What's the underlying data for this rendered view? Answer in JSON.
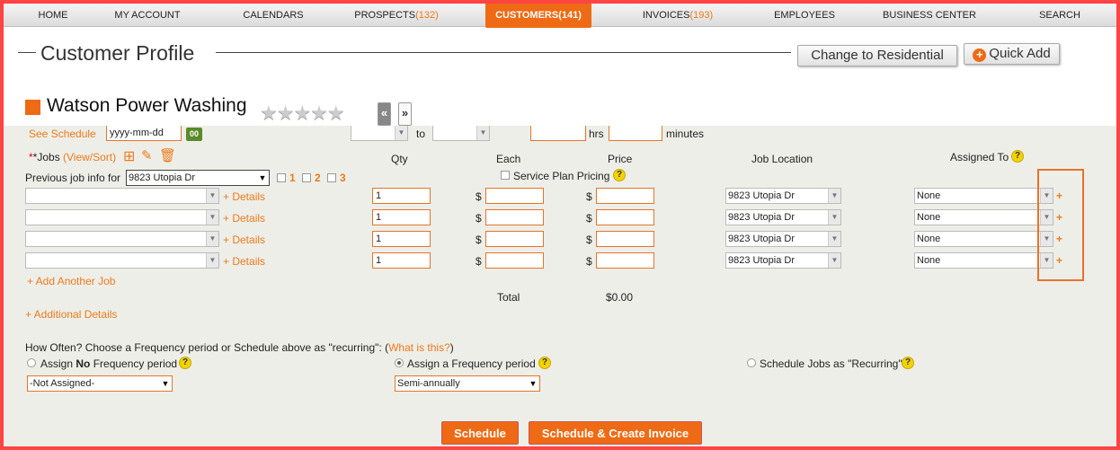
{
  "nav": {
    "home": "HOME",
    "my_account": "MY ACCOUNT",
    "calendars": "CALENDARS",
    "prospects": "PROSPECTS",
    "prospects_count": "(132)",
    "customers": "CUSTOMERS",
    "customers_count": "(141)",
    "invoices": "INVOICES",
    "invoices_count": "(193)",
    "employees": "EMPLOYEES",
    "business_center": "BUSINESS CENTER",
    "search": "SEARCH"
  },
  "header": {
    "title": "Customer Profile",
    "change_residential": "Change to Residential",
    "quick_add": "Quick Add"
  },
  "customer": {
    "name": "Watson Power Washing",
    "rating_stars": "★★★★★",
    "rating_value": 0,
    "prev_btn": "«",
    "next_btn": "»"
  },
  "schedule": {
    "see_schedule": "See Schedule",
    "date_placeholder": "yyyy-mm-dd",
    "calendar_icon_label": "00",
    "to": "to",
    "hrs": "hrs",
    "minutes": "minutes"
  },
  "jobs": {
    "label": "*Jobs",
    "view_sort": "(View/Sort)",
    "col_qty": "Qty",
    "col_each": "Each",
    "col_price": "Price",
    "col_location": "Job Location",
    "col_assigned": "Assigned To",
    "service_plan": "Service Plan Pricing",
    "prev_job_label": "Previous job info for",
    "prev_job_value": "9823 Utopia Dr",
    "opt1": "1",
    "opt2": "2",
    "opt3": "3",
    "rows": [
      {
        "details": "+ Details",
        "qty": "1",
        "currency": "$",
        "location": "9823 Utopia Dr",
        "assigned": "None",
        "add": "+"
      },
      {
        "details": "+ Details",
        "qty": "1",
        "currency": "$",
        "location": "9823 Utopia Dr",
        "assigned": "None",
        "add": "+"
      },
      {
        "details": "+ Details",
        "qty": "1",
        "currency": "$",
        "location": "9823 Utopia Dr",
        "assigned": "None",
        "add": "+"
      },
      {
        "details": "+ Details",
        "qty": "1",
        "currency": "$",
        "location": "9823 Utopia Dr",
        "assigned": "None",
        "add": "+"
      }
    ],
    "add_another": "+ Add Another Job",
    "total_label": "Total",
    "total_value": "$0.00",
    "additional_details": "+ Additional Details"
  },
  "frequency": {
    "question": "How Often? Choose a Frequency period or Schedule above as \"recurring\": (",
    "what_is_this": "What is this?",
    "close_paren": ")",
    "opt_none_prefix": "Assign ",
    "opt_none_bold": "No",
    "opt_none_suffix": " Frequency period",
    "opt_assign": "Assign a Frequency period",
    "opt_recurring": "Schedule Jobs as \"Recurring\"",
    "none_select": "-Not Assigned-",
    "period_select": "Semi-annually",
    "selected": "assign"
  },
  "actions": {
    "schedule": "Schedule",
    "schedule_invoice": "Schedule & Create Invoice"
  },
  "colors": {
    "accent": "#ee6a14",
    "frame": "#f44444",
    "panel": "#eeeee8"
  }
}
